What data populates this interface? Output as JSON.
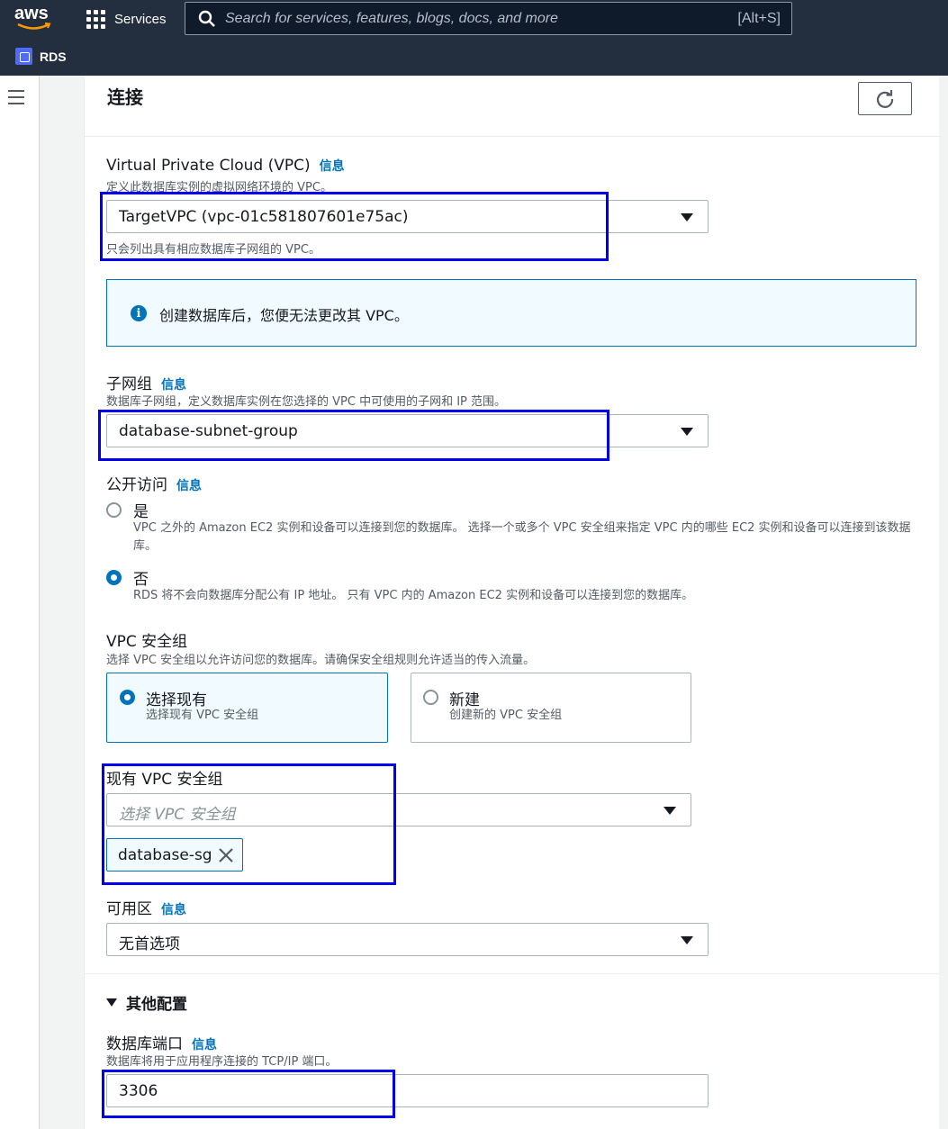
{
  "nav": {
    "logo_text": "aws",
    "services_label": "Services",
    "search_placeholder": "Search for services, features, blogs, docs, and more",
    "search_shortcut": "[Alt+S]",
    "service_name": "RDS"
  },
  "section": {
    "title": "连接"
  },
  "vpc": {
    "label": "Virtual Private Cloud (VPC)",
    "info": "信息",
    "description": "定义此数据库实例的虚拟网络环境的 VPC。",
    "selected": "TargetVPC (vpc-01c581807601e75ac)",
    "hint": "只会列出具有相应数据库子网组的 VPC。"
  },
  "alert": {
    "icon": "info-icon",
    "text": "创建数据库后，您便无法更改其 VPC。"
  },
  "subnet_group": {
    "label": "子网组",
    "info": "信息",
    "description": "数据库子网组，定义数据库实例在您选择的 VPC 中可使用的子网和 IP 范围。",
    "selected": "database-subnet-group"
  },
  "public_access": {
    "label": "公开访问",
    "info": "信息",
    "options": [
      {
        "title": "是",
        "description": "VPC 之外的 Amazon EC2 实例和设备可以连接到您的数据库。 选择一个或多个 VPC 安全组来指定 VPC 内的哪些 EC2 实例和设备可以连接到该数据库。",
        "selected": false
      },
      {
        "title": "否",
        "description": "RDS 将不会向数据库分配公有 IP 地址。 只有 VPC 内的 Amazon EC2 实例和设备可以连接到您的数据库。",
        "selected": true
      }
    ]
  },
  "security_group": {
    "label": "VPC 安全组",
    "description": "选择 VPC 安全组以允许访问您的数据库。请确保安全组规则允许适当的传入流量。",
    "tiles": [
      {
        "title": "选择现有",
        "description": "选择现有 VPC 安全组",
        "selected": true
      },
      {
        "title": "新建",
        "description": "创建新的 VPC 安全组",
        "selected": false
      }
    ],
    "existing_label": "现有 VPC 安全组",
    "existing_placeholder": "选择 VPC 安全组",
    "tokens": [
      "database-sg"
    ]
  },
  "availability_zone": {
    "label": "可用区",
    "info": "信息",
    "selected": "无首选项"
  },
  "additional_config": {
    "title": "其他配置",
    "port_label": "数据库端口",
    "port_info": "信息",
    "port_description": "数据库将用于应用程序连接的 TCP/IP 端口。",
    "port_value": "3306"
  },
  "colors": {
    "nav_bg": "#232f3e",
    "link": "#0073bb",
    "highlight": "#0000ee"
  }
}
